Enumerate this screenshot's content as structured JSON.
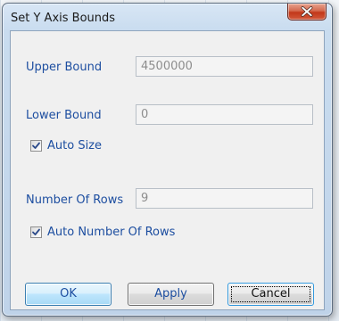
{
  "dialog": {
    "title": "Set Y Axis Bounds",
    "close_icon": "close-icon"
  },
  "fields": {
    "upper_bound": {
      "label": "Upper Bound",
      "value": "4500000"
    },
    "lower_bound": {
      "label": "Lower Bound",
      "value": "0"
    },
    "auto_size": {
      "label": "Auto Size",
      "checked": true
    },
    "number_of_rows": {
      "label": "Number Of Rows",
      "value": "9"
    },
    "auto_number_of_rows": {
      "label": "Auto Number Of Rows",
      "checked": true
    }
  },
  "buttons": {
    "ok": "OK",
    "apply": "Apply",
    "cancel": "Cancel"
  },
  "colors": {
    "label_text": "#1d4ea0",
    "close_button": "#c2381a",
    "button_hover": "#bee6fd"
  }
}
